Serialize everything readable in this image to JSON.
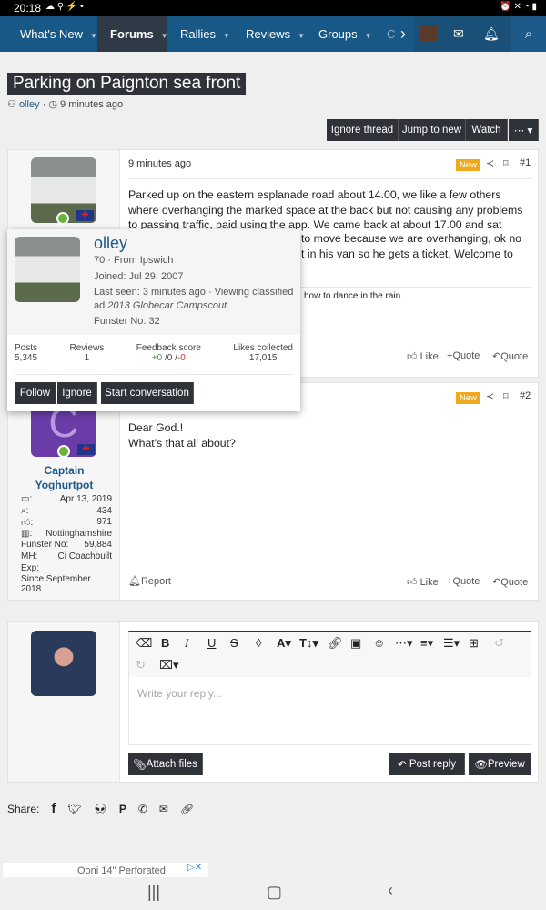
{
  "status": {
    "time": "20:18"
  },
  "nav": {
    "items": [
      "What's New",
      "Forums",
      "Rallies",
      "Reviews",
      "Groups",
      "C"
    ],
    "active": "Forums"
  },
  "thread": {
    "title": "Parking on Paignton sea front",
    "author": "olley",
    "age": "9 minutes ago"
  },
  "thread_buttons": {
    "ignore": "Ignore thread",
    "jump": "Jump to new",
    "watch": "Watch",
    "more": "⋯ ▾"
  },
  "post1": {
    "time": "9 minutes ago",
    "badge": "New",
    "num": "#1",
    "body": "Parked up on the eastern esplanade road about 14.00, we like a few others where overhanging the marked space at the back but not causing any problems to passing traffic, paid using the app. We came back at about 17.00 and sat having a",
    "body_tail": [
      "to move because we are overhanging, ok no",
      "t in his van so he gets a ticket, Welcome to"
    ],
    "signature": "how to dance in the rain.",
    "like": "Like",
    "multiquote": "Quote",
    "quote": "Quote"
  },
  "popup": {
    "name": "olley",
    "age_loc": "70 · From Ipswich",
    "joined": "Joined: Jul 29, 2007",
    "last_seen": "Last seen: 3 minutes ago · Viewing classified",
    "last_seen_ad_prefix": "ad ",
    "last_seen_ad": "2013 Globecar Campscout",
    "funster": "Funster No: 32",
    "stats": [
      {
        "label": "Posts",
        "value": "5,345"
      },
      {
        "label": "Reviews",
        "value": "1"
      },
      {
        "label": "Feedback score",
        "value": ""
      },
      {
        "label": "Likes collected",
        "value": "17,015"
      }
    ],
    "feedback": {
      "pos": "+0",
      "neu": " /0 /",
      "neg": "-0"
    },
    "follow": "Follow",
    "ignore": "Ignore",
    "start": "Start conversation"
  },
  "post2": {
    "badge": "New",
    "num": "#2",
    "body": [
      "Dear God.!",
      "What's that all about?"
    ],
    "author": [
      "Captain",
      "Yoghurtpot"
    ],
    "avatar_letter": "C",
    "stats": [
      {
        "k": ":",
        "v": "Apr 13, 2019"
      },
      {
        "k": ":",
        "v": "434"
      },
      {
        "k": ":",
        "v": "971"
      },
      {
        "k": ":",
        "v": "Nottinghamshire"
      },
      {
        "k": "Funster No:",
        "v": "59,884"
      },
      {
        "k": "MH:",
        "v": "Ci Coachbuilt"
      },
      {
        "k": "Exp:",
        "v": ""
      }
    ],
    "exp": "Since September 2018",
    "report": "Report",
    "like": "Like",
    "multiquote": "Quote",
    "quote": "Quote"
  },
  "reply": {
    "placeholder": "Write your reply...",
    "attach": "Attach files",
    "post": "Post reply",
    "preview": "Preview"
  },
  "share": {
    "label": "Share:"
  },
  "ad": {
    "text": "Ooni 14\" Perforated"
  },
  "colors": {
    "nav": "#185886",
    "accent": "#1d5a8a",
    "dark_button": "#2f3238",
    "new_badge": "#f0a81c"
  }
}
